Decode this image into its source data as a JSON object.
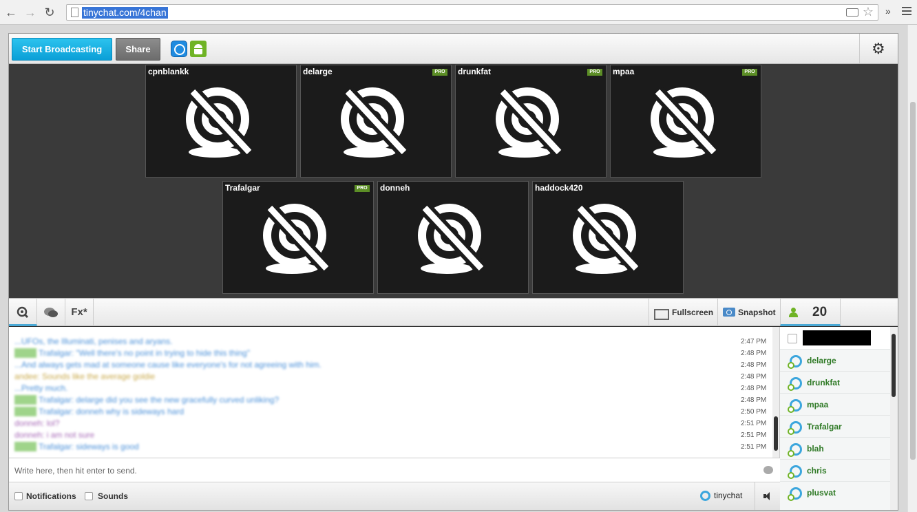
{
  "browser": {
    "url": "tinychat.com/4chan",
    "more_label": "»"
  },
  "toolbar": {
    "broadcast_label": "Start Broadcasting",
    "share_label": "Share"
  },
  "videos": [
    {
      "name": "cpnblankk",
      "pro": false
    },
    {
      "name": "delarge",
      "pro": true
    },
    {
      "name": "drunkfat",
      "pro": true
    },
    {
      "name": "mpaa",
      "pro": true
    },
    {
      "name": "Trafalgar",
      "pro": true
    },
    {
      "name": "donneh",
      "pro": false
    },
    {
      "name": "haddock420",
      "pro": false
    }
  ],
  "pro_label": "PRO",
  "chat_toolbar": {
    "fx_label": "Fx*",
    "fullscreen_label": "Fullscreen",
    "snapshot_label": "Snapshot",
    "user_count": "20"
  },
  "chat": {
    "messages": [
      {
        "author": "",
        "text": "...UFOs, the Illuminati, penises and aryans.",
        "time": "2:47 PM",
        "color": "#4a90d9"
      },
      {
        "author": "Trafalgar",
        "badge": "MOD",
        "text": "Trafalgar: \"Well there's no point in trying to hide this thing\"",
        "time": "2:48 PM",
        "color": "#4a90d9"
      },
      {
        "author": "",
        "text": "...And always gets mad at someone cause like everyone's for not agreeing with him.",
        "time": "2:48 PM",
        "color": "#4a90d9"
      },
      {
        "author": "andee",
        "text": "andee: Sounds like the average goldie",
        "time": "2:48 PM",
        "color": "#c9a94a"
      },
      {
        "author": "",
        "text": "...Pretty much.",
        "time": "2:48 PM",
        "color": "#4a90d9"
      },
      {
        "author": "Trafalgar",
        "badge": "MOD",
        "text": "Trafalgar: delarge did you see the new gracefully curved unliking?",
        "time": "2:48 PM",
        "color": "#4a90d9"
      },
      {
        "author": "Trafalgar",
        "badge": "MOD",
        "text": "Trafalgar: donneh why is sideways hard",
        "time": "2:50 PM",
        "color": "#4a90d9"
      },
      {
        "author": "donneh",
        "text": "donneh: lol?",
        "time": "2:51 PM",
        "color": "#a86bb8"
      },
      {
        "author": "donneh",
        "text": "donneh: i am not sure",
        "time": "2:51 PM",
        "color": "#a86bb8"
      },
      {
        "author": "Trafalgar",
        "badge": "MOD",
        "text": "Trafalgar: sideways is good",
        "time": "2:51 PM",
        "color": "#4a90d9"
      }
    ],
    "input_placeholder": "Write here, then hit enter to send."
  },
  "bottom": {
    "notifications_label": "Notifications",
    "sounds_label": "Sounds",
    "brand_label": "tinychat"
  },
  "users": [
    {
      "name": "delarge"
    },
    {
      "name": "drunkfat"
    },
    {
      "name": "mpaa"
    },
    {
      "name": "Trafalgar"
    },
    {
      "name": "blah"
    },
    {
      "name": "chris"
    },
    {
      "name": "plusvat"
    }
  ]
}
